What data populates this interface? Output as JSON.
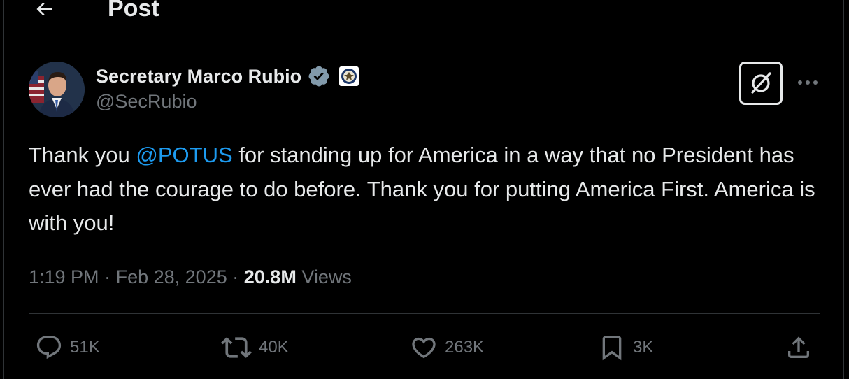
{
  "header": {
    "title": "Post",
    "back_icon": "arrow-left-icon"
  },
  "author": {
    "display_name": "Secretary Marco Rubio",
    "handle": "@SecRubio",
    "verified_color": "#829aab",
    "affiliation_icon": "state-department-seal-icon"
  },
  "post": {
    "text_before": "Thank you ",
    "mention": "@POTUS",
    "text_after": " for standing up for America in a way that no President has ever had the courage to do before. Thank you for putting America First. America is with you!",
    "time": "1:19 PM",
    "separator": "·",
    "date": "Feb 28, 2025",
    "views_count": "20.8M",
    "views_label": "Views"
  },
  "actions": {
    "replies": "51K",
    "reposts": "40K",
    "likes": "263K",
    "bookmarks": "3K"
  },
  "colors": {
    "background": "#000000",
    "text": "#e7e9ea",
    "secondary": "#71767b",
    "mention": "#1d9bf0",
    "divider": "#2f3336"
  }
}
